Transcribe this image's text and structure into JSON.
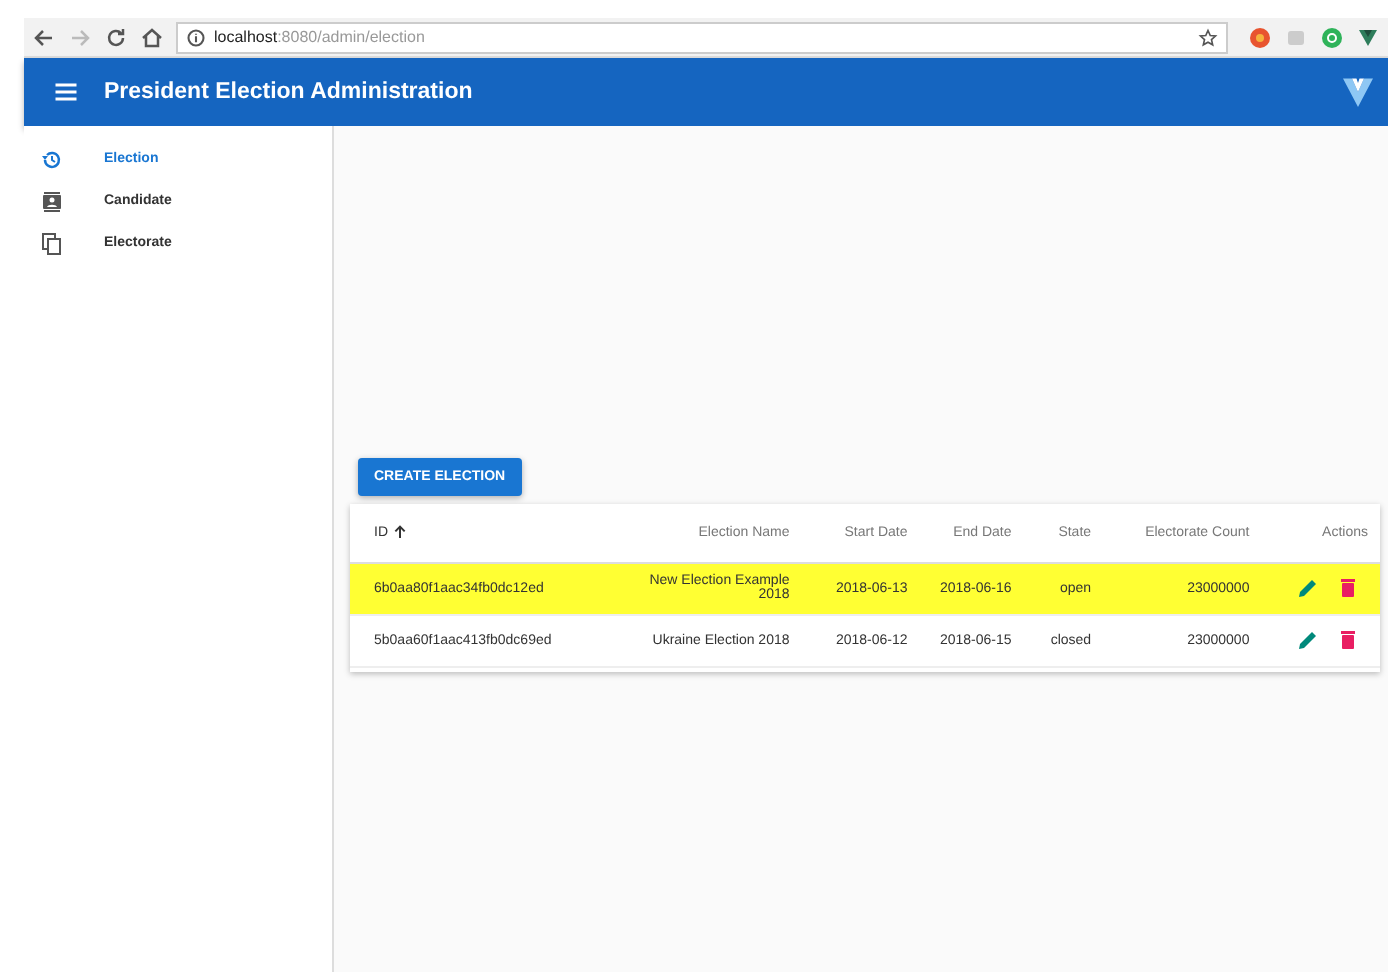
{
  "browser": {
    "url_host": "localhost",
    "url_path": ":8080/admin/election"
  },
  "app_bar": {
    "title": "President Election Administration"
  },
  "sidebar": {
    "items": [
      {
        "label": "Election",
        "selected": true
      },
      {
        "label": "Candidate",
        "selected": false
      },
      {
        "label": "Electorate",
        "selected": false
      }
    ]
  },
  "create_button": "CREATE ELECTION",
  "table": {
    "columns": [
      {
        "label": "ID",
        "sorted": true
      },
      {
        "label": "Election Name",
        "sorted": false
      },
      {
        "label": "Start Date",
        "sorted": false
      },
      {
        "label": "End Date",
        "sorted": false
      },
      {
        "label": "State",
        "sorted": false
      },
      {
        "label": "Electorate Count",
        "sorted": false
      },
      {
        "label": "Actions",
        "sorted": false
      }
    ],
    "rows": [
      {
        "cells": [
          "6b0aa80f1aac34fb0dc12ed",
          "New Election Example 2018",
          "2018-06-13",
          "2018-06-16",
          "open",
          "23000000"
        ],
        "highlighted": true
      },
      {
        "cells": [
          "5b0aa60f1aac413fb0dc69ed",
          "Ukraine Election 2018",
          "2018-06-12",
          "2018-06-15",
          "closed",
          "23000000"
        ],
        "highlighted": false
      }
    ]
  }
}
